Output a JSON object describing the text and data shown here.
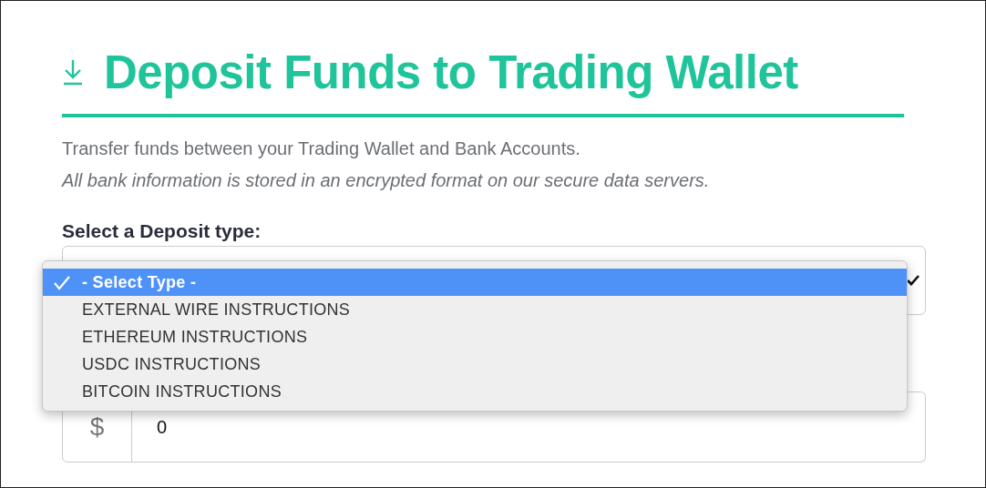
{
  "header": {
    "title": "Deposit Funds to Trading Wallet"
  },
  "intro": {
    "text": "Transfer funds between your Trading Wallet and Bank Accounts.",
    "note": "All bank information is stored in an encrypted format on our secure data servers."
  },
  "deposit_type": {
    "label": "Select a Deposit type:",
    "expanded": true,
    "options": [
      {
        "label": "- Select Type -",
        "selected": true
      },
      {
        "label": "EXTERNAL WIRE INSTRUCTIONS",
        "selected": false
      },
      {
        "label": "ETHEREUM INSTRUCTIONS",
        "selected": false
      },
      {
        "label": "USDC INSTRUCTIONS",
        "selected": false
      },
      {
        "label": "BITCOIN INSTRUCTIONS",
        "selected": false
      }
    ]
  },
  "amount": {
    "prefix": "$",
    "value": "0"
  }
}
